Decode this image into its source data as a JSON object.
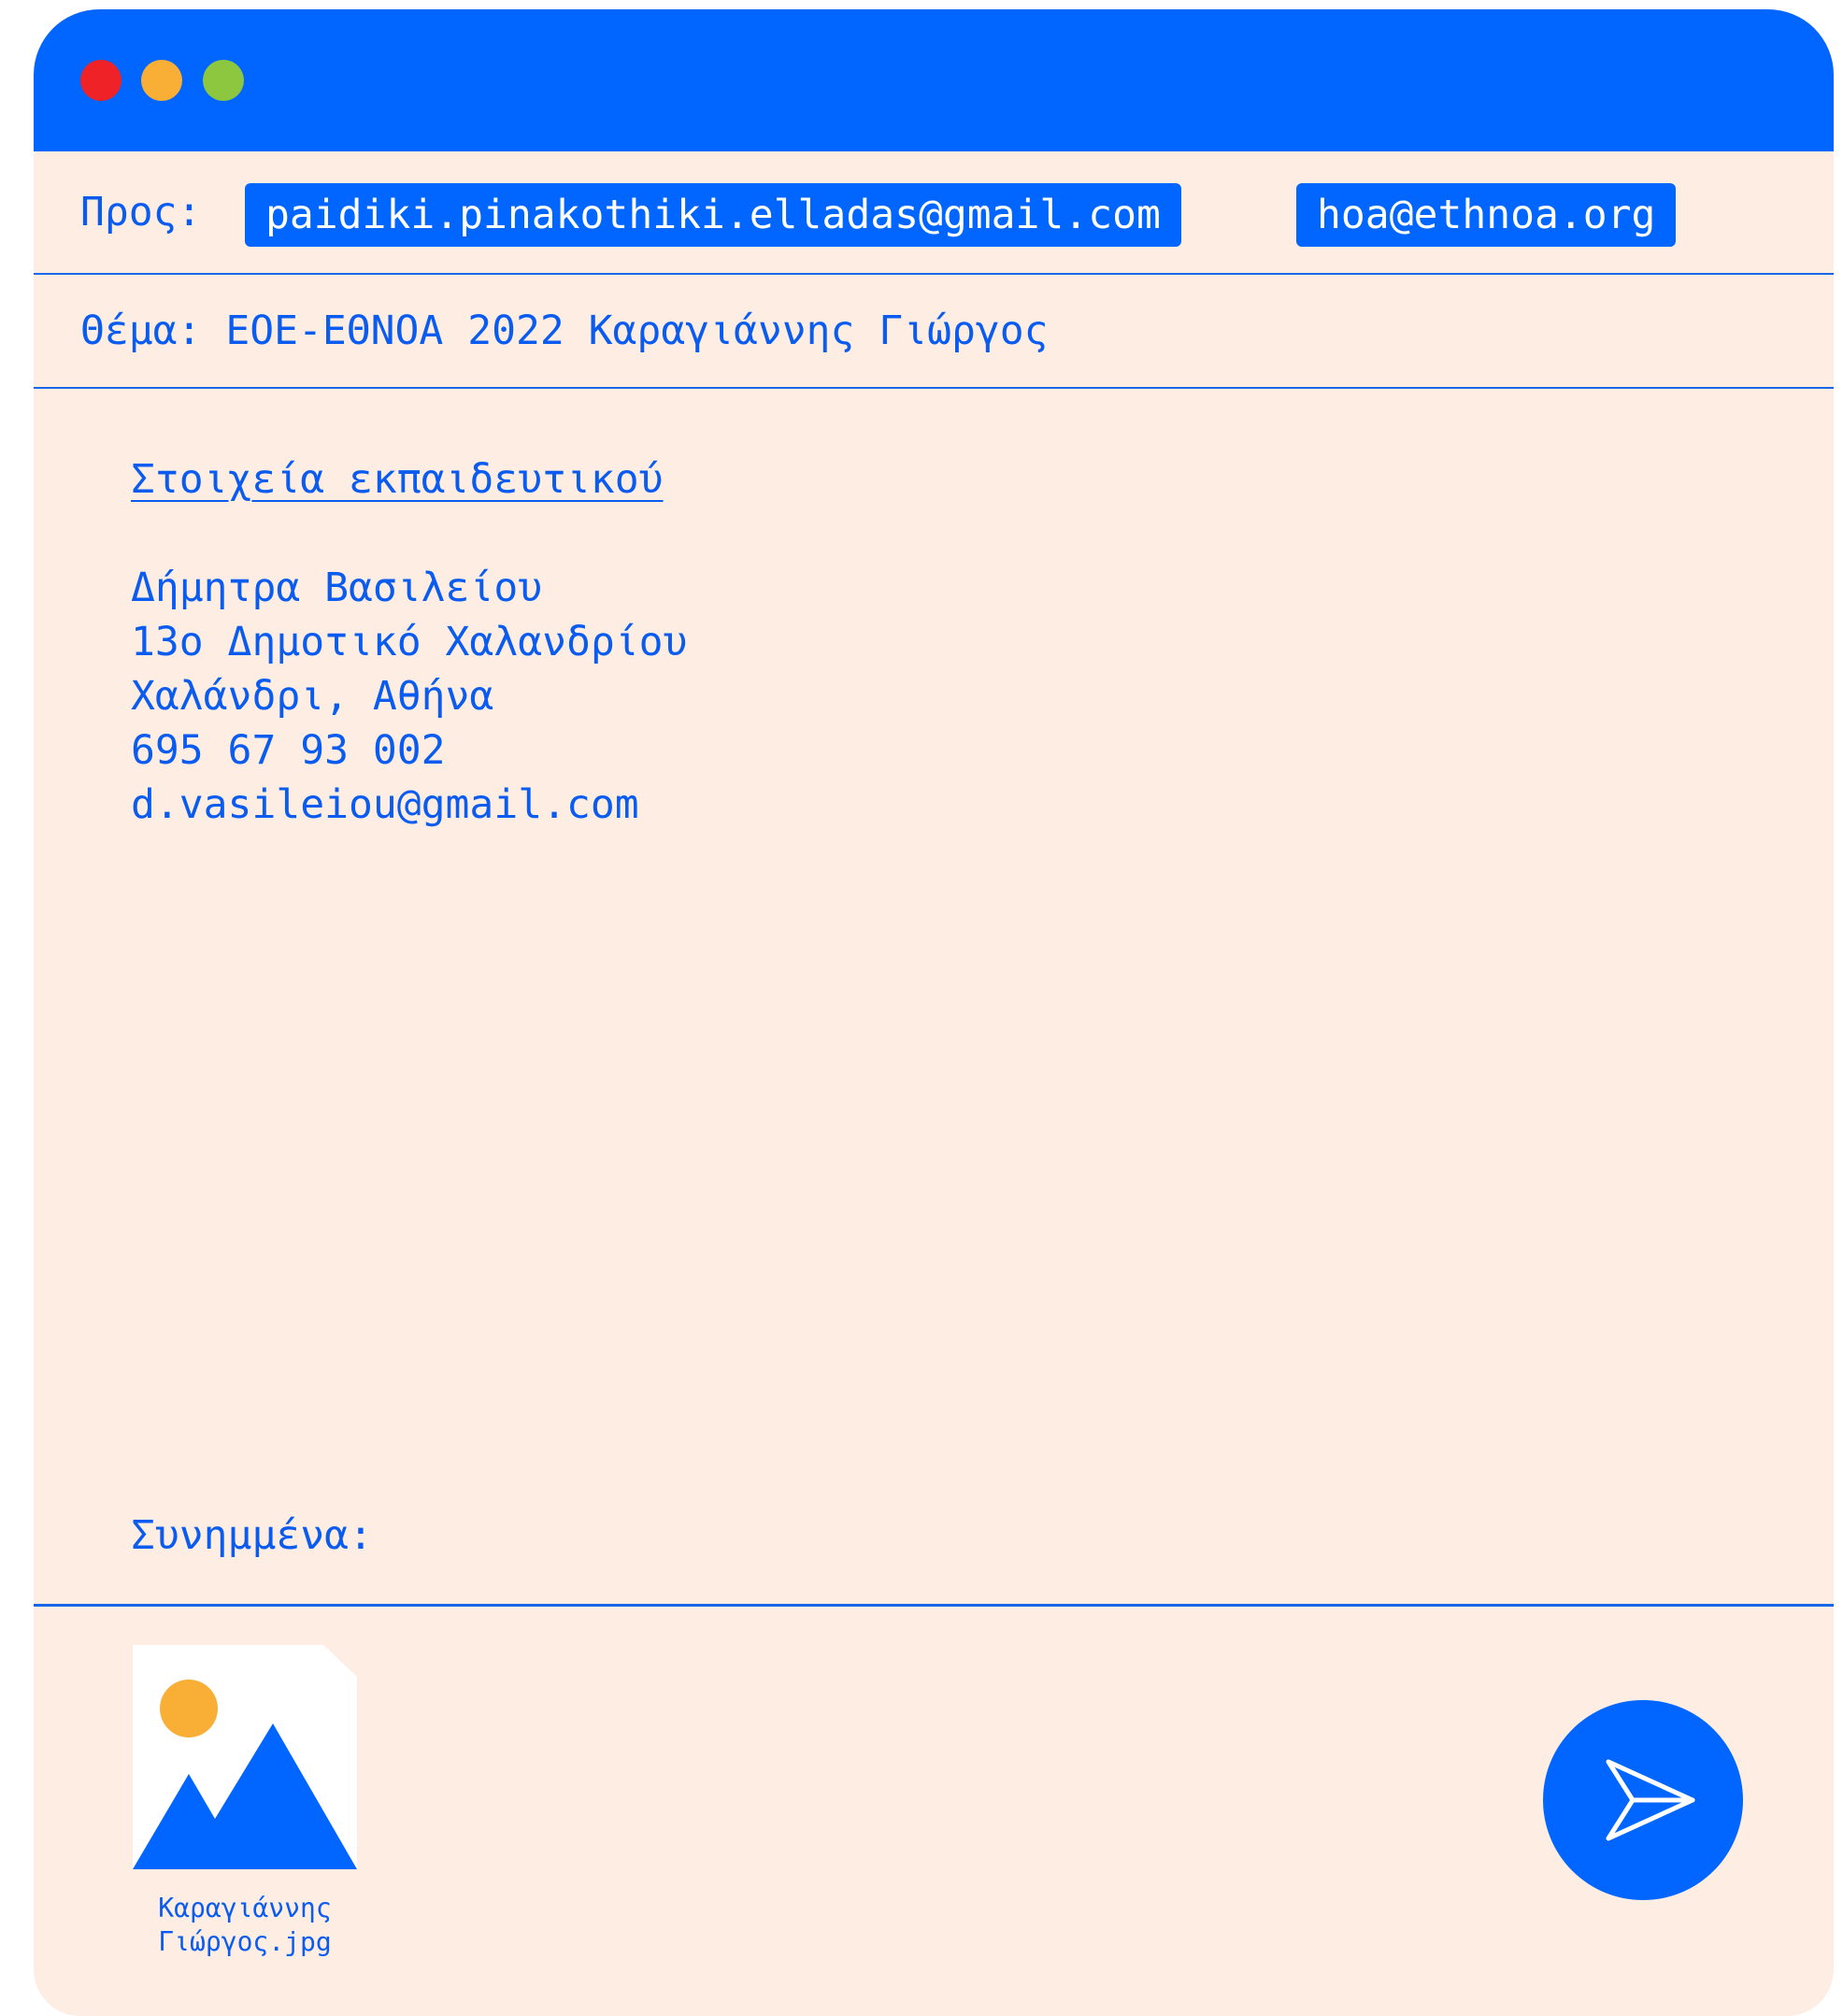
{
  "window_controls": {
    "close_color": "#ee2227",
    "minimize_color": "#f9ae35",
    "maximize_color": "#8dc63f"
  },
  "to": {
    "label": "Προς:",
    "recipients": [
      "paidiki.pinakothiki.elladas@gmail.com",
      "hoa@ethnoa.org"
    ]
  },
  "subject": {
    "text": "Θέμα: ΕΟΕ-ΕΘΝΟΑ 2022 Καραγιάννης Γιώργος"
  },
  "body": {
    "section_title": "Στοιχεία εκπαιδευτικού",
    "lines": [
      "Δήμητρα Βασιλείου",
      "13ο Δημοτικό Χαλανδρίου",
      "Χαλάνδρι, Αθήνα",
      "695 67 93 002",
      "d.vasileiou@gmail.com"
    ]
  },
  "attachments": {
    "label": "Συνημμένα:",
    "files": [
      {
        "name_line1": "Καραγιάννης",
        "name_line2": "Γιώργος.jpg",
        "icon": "image-file-icon"
      }
    ]
  },
  "send_button": {
    "icon": "send-icon"
  },
  "colors": {
    "accent": "#0066ff",
    "background": "#fdede2",
    "text": "#0a5cf0",
    "sun": "#f9ae35"
  }
}
